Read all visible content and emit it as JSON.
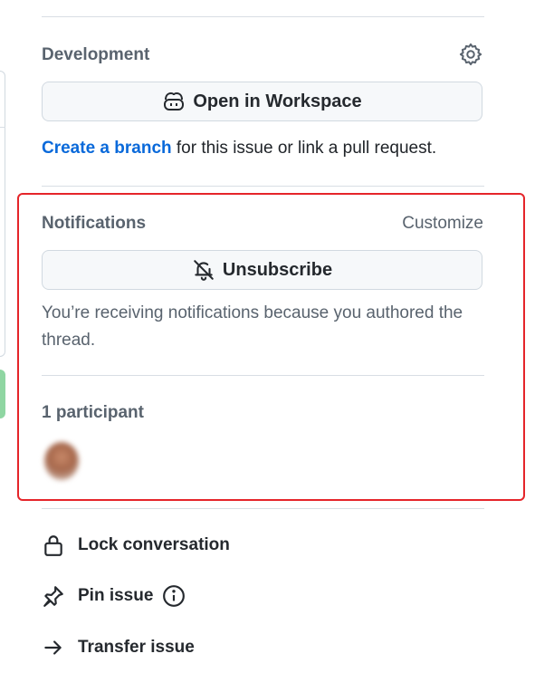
{
  "development": {
    "title": "Development",
    "settings_icon": "gear-icon",
    "workspace_button": "Open in Workspace",
    "workspace_icon": "copilot-icon",
    "create_branch_link": "Create a branch",
    "create_branch_rest": " for this issue or link a pull request."
  },
  "notifications": {
    "title": "Notifications",
    "customize": "Customize",
    "unsubscribe_button": "Unsubscribe",
    "unsubscribe_icon": "bell-slash-icon",
    "reason": "You’re receiving notifications because you authored the thread."
  },
  "participants": {
    "title": "1 participant"
  },
  "actions": [
    {
      "label": "Lock conversation",
      "icon": "lock-icon"
    },
    {
      "label": "Pin issue",
      "icon": "pin-icon"
    },
    {
      "label": "Transfer issue",
      "icon": "arrow-right-icon"
    }
  ],
  "colors": {
    "link": "#0969da",
    "highlight_border": "#e5252a",
    "left_accent": "#8fd6a2"
  }
}
